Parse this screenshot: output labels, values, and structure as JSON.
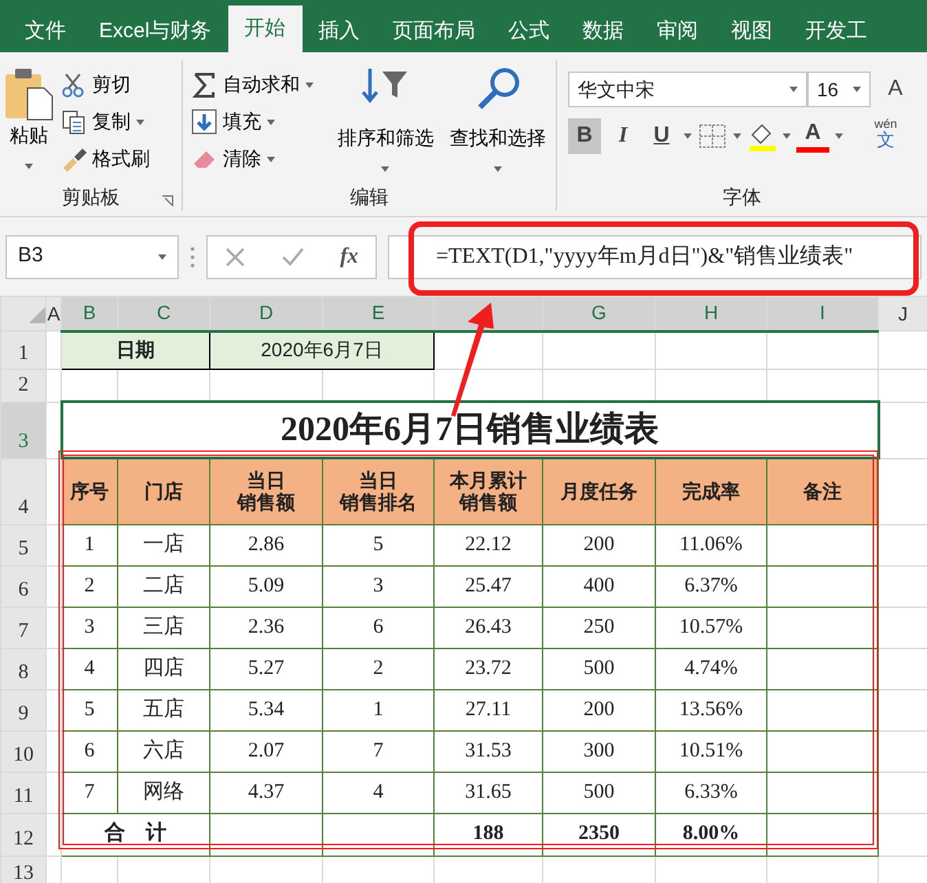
{
  "tabs": [
    {
      "label": "文件",
      "selected": false
    },
    {
      "label": "Excel与财务",
      "selected": false
    },
    {
      "label": "开始",
      "selected": true
    },
    {
      "label": "插入",
      "selected": false
    },
    {
      "label": "页面布局",
      "selected": false
    },
    {
      "label": "公式",
      "selected": false
    },
    {
      "label": "数据",
      "selected": false
    },
    {
      "label": "审阅",
      "selected": false
    },
    {
      "label": "视图",
      "selected": false
    },
    {
      "label": "开发工",
      "selected": false
    }
  ],
  "clipboard": {
    "paste": "粘贴",
    "cut": "剪切",
    "copy": "复制",
    "format_painter": "格式刷",
    "label": "剪贴板"
  },
  "editing": {
    "autosum": "自动求和",
    "fill": "填充",
    "clear": "清除",
    "sort_filter": "排序和筛选",
    "find_select": "查找和选择",
    "label": "编辑"
  },
  "font": {
    "font_name": "华文中宋",
    "font_size": "16",
    "grow_label": "A",
    "style_buttons": [
      {
        "label": "B",
        "selected": true
      },
      {
        "label": "I",
        "selected": false
      },
      {
        "label": "U",
        "selected": false
      }
    ],
    "font_color_label": "A",
    "phonetic_pinyin": "wén",
    "phonetic_char": "文",
    "label": "字体"
  },
  "formula_bar": {
    "name_box": "B3",
    "function_label": "fx",
    "formula": "=TEXT(D1,\"yyyy年m月d日\")&\"销售业绩表\""
  },
  "columns": [
    {
      "label": "A",
      "selected": false
    },
    {
      "label": "B",
      "selected": true
    },
    {
      "label": "C",
      "selected": true
    },
    {
      "label": "D",
      "selected": true
    },
    {
      "label": "E",
      "selected": true
    },
    {
      "selected": true
    },
    {
      "label": "G",
      "selected": true
    },
    {
      "label": "H",
      "selected": true
    },
    {
      "label": "I",
      "selected": true
    },
    {
      "label": "J",
      "selected": false
    }
  ],
  "rows": [
    {
      "number": "1",
      "selected": false
    },
    {
      "number": "2",
      "selected": false
    },
    {
      "number": "3",
      "selected": true
    },
    {
      "number": "4",
      "selected": false
    },
    {
      "number": "5",
      "selected": false
    },
    {
      "number": "6",
      "selected": false
    },
    {
      "number": "7",
      "selected": false
    },
    {
      "number": "8",
      "selected": false
    },
    {
      "number": "9",
      "selected": false
    },
    {
      "number": "10",
      "selected": false
    },
    {
      "number": "11",
      "selected": false
    },
    {
      "number": "12",
      "selected": false
    },
    {
      "number": "13",
      "selected": false
    }
  ],
  "sheet": {
    "date_label": "日期",
    "date_value": "2020年6月7日",
    "title": "2020年6月7日销售业绩表",
    "headers": [
      [
        "序号"
      ],
      [
        "门店"
      ],
      [
        "当日",
        "销售额"
      ],
      [
        "当日",
        "销售排名"
      ],
      [
        "本月累计",
        "销售额"
      ],
      [
        "月度任务"
      ],
      [
        "完成率"
      ],
      [
        "备注"
      ]
    ],
    "records": [
      [
        "1",
        "一店",
        "2.86",
        "5",
        "22.12",
        "200",
        "11.06%"
      ],
      [
        "2",
        "二店",
        "5.09",
        "3",
        "25.47",
        "400",
        "6.37%"
      ],
      [
        "3",
        "三店",
        "2.36",
        "6",
        "26.43",
        "250",
        "10.57%"
      ],
      [
        "4",
        "四店",
        "5.27",
        "2",
        "23.72",
        "500",
        "4.74%"
      ],
      [
        "5",
        "五店",
        "5.34",
        "1",
        "27.11",
        "200",
        "13.56%"
      ],
      [
        "6",
        "六店",
        "2.07",
        "7",
        "31.53",
        "300",
        "10.51%"
      ],
      [
        "7",
        "网络",
        "4.37",
        "4",
        "31.65",
        "500",
        "6.33%"
      ]
    ],
    "total": {
      "label": "合    计",
      "monthly_total": "188",
      "task_total": "2350",
      "rate": "8.00%"
    }
  }
}
